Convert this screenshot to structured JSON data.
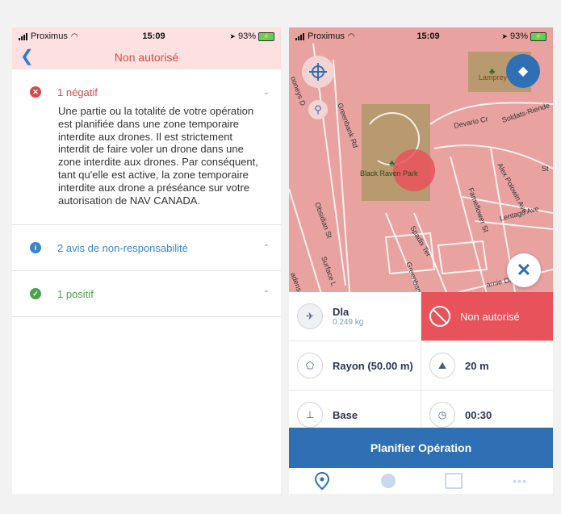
{
  "left": {
    "status": {
      "carrier": "Proximus",
      "time": "15:09",
      "battery": "93%"
    },
    "header": {
      "title": "Non autorisé"
    },
    "sections": [
      {
        "label": "1 négatif",
        "color": "#d94848",
        "icon": "x-circle-icon",
        "body": "Une partie ou la totalité de votre opération est planifiée dans une zone temporaire interdite aux drones. Il est strictement interdit de faire voler un drone dans une zone interdite aux drones. Par conséquent, tant qu'elle est active, la zone temporaire interdite aux drone a préséance sur votre autorisation de NAV CANADA."
      },
      {
        "label": "2 avis de non-responsabilité",
        "color": "#3a86cc",
        "icon": "info-icon"
      },
      {
        "label": "1 positif",
        "color": "#4aa34a",
        "icon": "check-circle-icon"
      }
    ]
  },
  "right": {
    "status": {
      "carrier": "Proximus",
      "time": "15:09",
      "battery": "93%"
    },
    "map_labels": {
      "lamprey": "Lamprey Park",
      "black_raven": "Black Raven Park",
      "devario": "Devario Cr",
      "soldats": "Soldats-Riende",
      "alex_polowin": "Alex Polowin Ave",
      "lentago": "Lentago Ave",
      "fameflower": "Fameflower St",
      "obsidian": "Obsidian St",
      "spadix": "Spadix Ter",
      "greenbank_rd": "Greenbank Rd",
      "greenbank": "Greenbank",
      "surface": "Surface L",
      "arnie": "arnie Dr",
      "rooneys": "ooneys D",
      "cadens": "adens",
      "st": "St"
    },
    "info": {
      "drone_name": "Dla",
      "drone_weight": "0.249 kg",
      "status": "Non autorisé",
      "radius": "Rayon (50.00 m)",
      "altitude": "20 m",
      "base": "Base",
      "duration": "00:30"
    },
    "plan_button": "Planifier Opération",
    "colors": {
      "primary": "#2f6fb3",
      "alert": "#e8525a",
      "map_overlay": "#e8a3a1"
    }
  }
}
